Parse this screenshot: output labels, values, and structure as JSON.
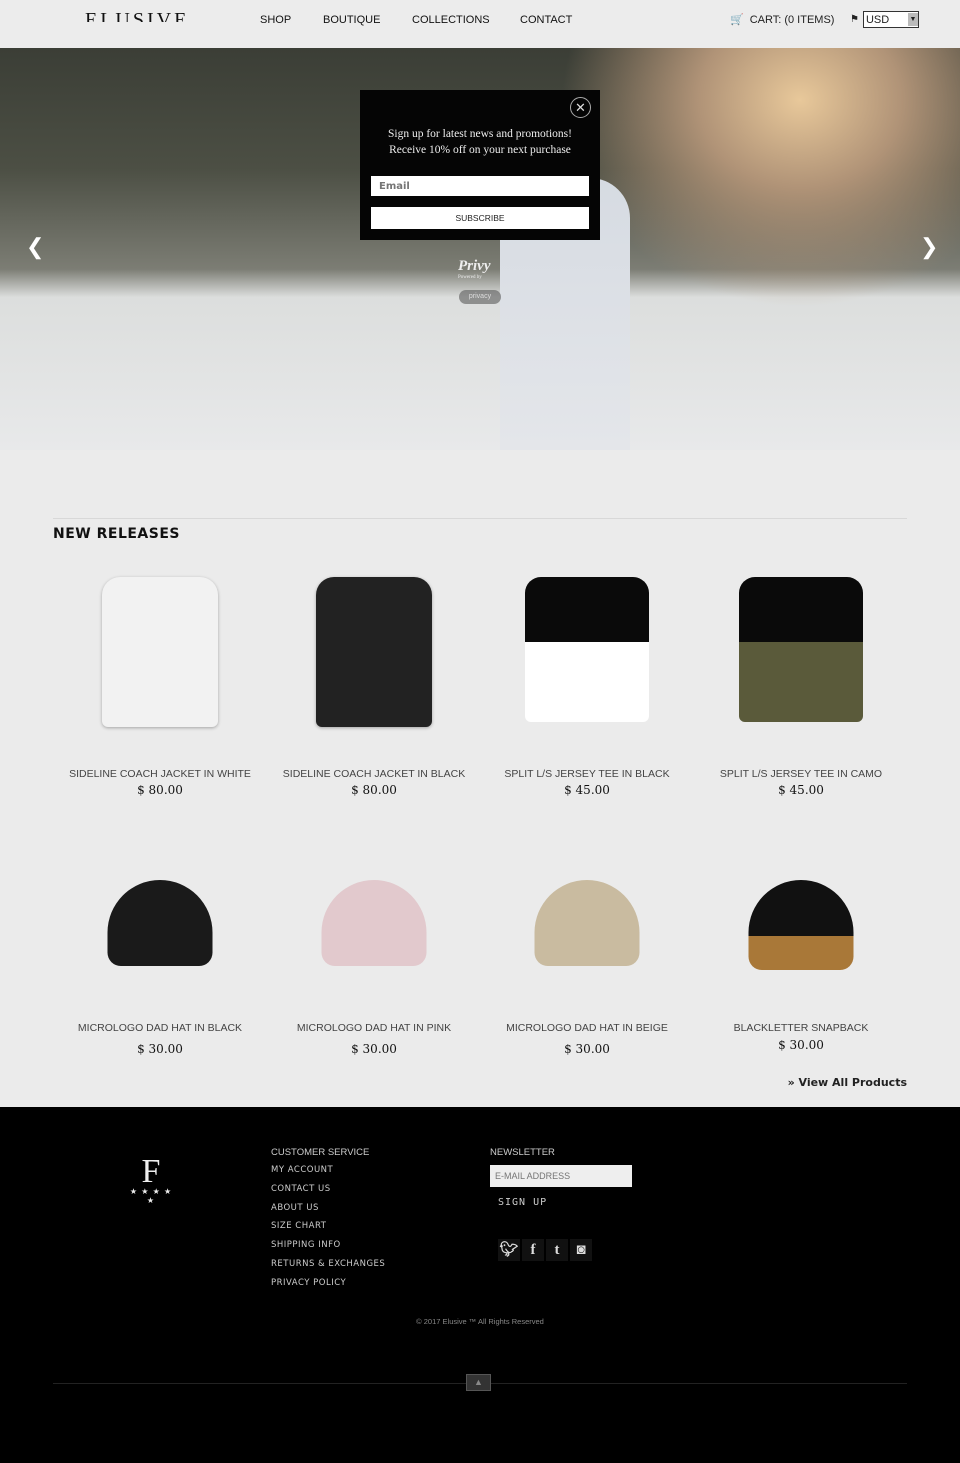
{
  "header": {
    "logo": "ELUSIVE",
    "nav": [
      "SHOP",
      "BOUTIQUE",
      "COLLECTIONS",
      "CONTACT"
    ],
    "cart": "CART: (0 ITEMS)",
    "currency": "USD"
  },
  "popup": {
    "line1": "Sign up for latest news and promotions!",
    "line2": "Receive 10% off on your next purchase",
    "email_placeholder": "Email",
    "subscribe": "SUBSCRIBE",
    "powered": "Powered by",
    "privy": "Privy",
    "privacy": "privacy"
  },
  "section_title": "NEW RELEASES",
  "products": [
    {
      "name": "SIDELINE COACH JACKET IN WHITE",
      "price": "$ 80.00",
      "type": "jacket",
      "color": "#f2f2f2"
    },
    {
      "name": "SIDELINE COACH JACKET IN BLACK",
      "price": "$ 80.00",
      "type": "jacket",
      "color": "#222222"
    },
    {
      "name": "SPLIT L/S JERSEY TEE IN BLACK",
      "price": "$ 45.00",
      "type": "tee",
      "color": "#ffffff"
    },
    {
      "name": "SPLIT L/S JERSEY TEE IN CAMO",
      "price": "$ 45.00",
      "type": "tee",
      "color": "#5a5a3a"
    },
    {
      "name": "MICROLOGO DAD HAT IN BLACK",
      "price": "$ 30.00",
      "type": "hat",
      "color": "#1a1a1a"
    },
    {
      "name": "MICROLOGO DAD HAT IN PINK",
      "price": "$ 30.00",
      "type": "hat",
      "color": "#e2c9cd"
    },
    {
      "name": "MICROLOGO DAD HAT IN BEIGE",
      "price": "$ 30.00",
      "type": "hat",
      "color": "#c9bba0"
    },
    {
      "name": "BLACKLETTER SNAPBACK",
      "price": "$ 30.00",
      "type": "snap",
      "color": "#111111"
    }
  ],
  "view_all": "» View All Products",
  "footer": {
    "customer_service": "CUSTOMER SERVICE",
    "links": [
      "MY ACCOUNT",
      "CONTACT US",
      "ABOUT US",
      "SIZE CHART",
      "SHIPPING INFO",
      "RETURNS & EXCHANGES",
      "PRIVACY POLICY"
    ],
    "newsletter": "NEWSLETTER",
    "email_placeholder": "E-MAIL ADDRESS",
    "sign_up": "SIGN UP",
    "social": [
      "twitter",
      "facebook",
      "tumblr",
      "instagram"
    ],
    "copyright": "© 2017 Elusive ™ All Rights Reserved",
    "logo_letter": "F"
  }
}
